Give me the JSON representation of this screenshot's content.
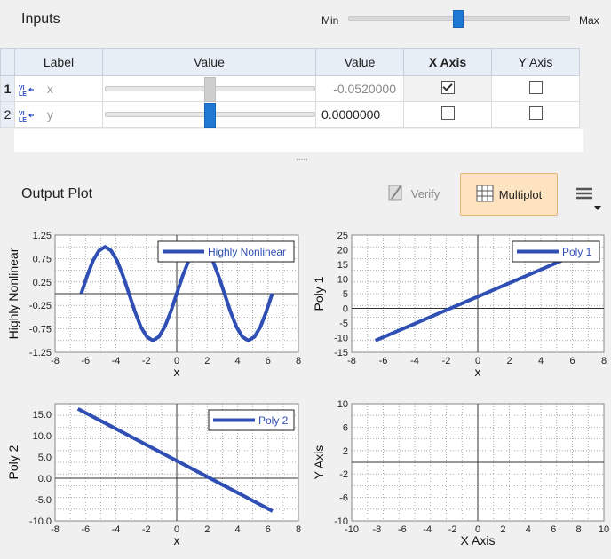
{
  "inputs": {
    "title": "Inputs",
    "slider": {
      "min_label": "Min",
      "max_label": "Max",
      "position": 0.5
    },
    "columns": [
      "Label",
      "Value",
      "Value",
      "X Axis",
      "Y Axis"
    ],
    "rows": [
      {
        "num": "1",
        "label": "x",
        "value": "-0.0520000",
        "x_axis": true,
        "y_axis": false,
        "slider_position": 0.5
      },
      {
        "num": "2",
        "label": "y",
        "value": "0.0000000",
        "x_axis": false,
        "y_axis": false,
        "slider_position": 0.5
      }
    ],
    "splitter": "....."
  },
  "output": {
    "title": "Output Plot",
    "verify_label": "Verify",
    "multiplot_label": "Multiplot"
  },
  "chart_data": [
    {
      "type": "line",
      "xlabel": "x",
      "ylabel": "Highly Nonlinear",
      "xlim": [
        -8,
        8
      ],
      "ylim": [
        -1.25,
        1.25
      ],
      "xticks": [
        "-8",
        "-6",
        "-4",
        "-2",
        "0",
        "2",
        "4",
        "6",
        "8"
      ],
      "yticks": [
        "1.25",
        "0.75",
        "0.25",
        "-0.25",
        "-0.75",
        "-1.25"
      ],
      "series": [
        {
          "name": "Highly Nonlinear",
          "color": "#2f4fb5",
          "x": [
            -6.28,
            -5.89,
            -5.5,
            -5.11,
            -4.71,
            -4.32,
            -3.93,
            -3.53,
            -3.14,
            -2.75,
            -2.36,
            -1.96,
            -1.57,
            -1.18,
            -0.79,
            -0.39,
            0,
            0.39,
            0.79,
            1.18,
            1.57,
            1.96,
            2.36,
            2.75,
            3.14,
            3.53,
            3.93,
            4.32,
            4.71,
            5.11,
            5.5,
            5.89,
            6.28
          ],
          "y": [
            0,
            0.38,
            0.71,
            0.92,
            1,
            0.92,
            0.71,
            0.38,
            0,
            -0.38,
            -0.71,
            -0.92,
            -1,
            -0.92,
            -0.71,
            -0.38,
            0,
            0.38,
            0.71,
            0.92,
            1,
            0.92,
            0.71,
            0.38,
            0,
            -0.38,
            -0.71,
            -0.92,
            -1,
            -0.92,
            -0.71,
            -0.38,
            0
          ]
        }
      ]
    },
    {
      "type": "line",
      "xlabel": "x",
      "ylabel": "Poly 1",
      "xlim": [
        -8,
        8
      ],
      "ylim": [
        -15,
        25
      ],
      "xticks": [
        "-8",
        "-6",
        "-4",
        "-2",
        "0",
        "2",
        "4",
        "6",
        "8"
      ],
      "yticks": [
        "25",
        "20",
        "15",
        "10",
        "5",
        "0",
        "-5",
        "-10",
        "-15"
      ],
      "series": [
        {
          "name": "Poly 1",
          "color": "#2f4fb5",
          "x": [
            -6.5,
            6.5
          ],
          "y": [
            -11,
            19
          ]
        }
      ]
    },
    {
      "type": "line",
      "xlabel": "x",
      "ylabel": "Poly 2",
      "xlim": [
        -8,
        8
      ],
      "ylim": [
        -10,
        17.5
      ],
      "xticks": [
        "-8",
        "-6",
        "-4",
        "-2",
        "0",
        "2",
        "4",
        "6",
        "8"
      ],
      "yticks": [
        "15.0",
        "10.0",
        "5.0",
        "0.0",
        "-5.0",
        "-10.0"
      ],
      "ytick_values": [
        15,
        10,
        5,
        0,
        -5,
        -10
      ],
      "series": [
        {
          "name": "Poly 2",
          "color": "#2f4fb5",
          "x": [
            -6.5,
            6.3
          ],
          "y": [
            16.3,
            -7.7
          ]
        }
      ]
    },
    {
      "type": "line",
      "xlabel": "X Axis",
      "ylabel": "Y Axis",
      "xlim": [
        -10,
        10
      ],
      "ylim": [
        -10,
        10
      ],
      "xticks": [
        "-10",
        "-8",
        "-6",
        "-4",
        "-2",
        "0",
        "2",
        "4",
        "6",
        "8",
        "10"
      ],
      "yticks": [
        "10",
        "6",
        "2",
        "-2",
        "-6",
        "-10"
      ],
      "series": []
    }
  ]
}
